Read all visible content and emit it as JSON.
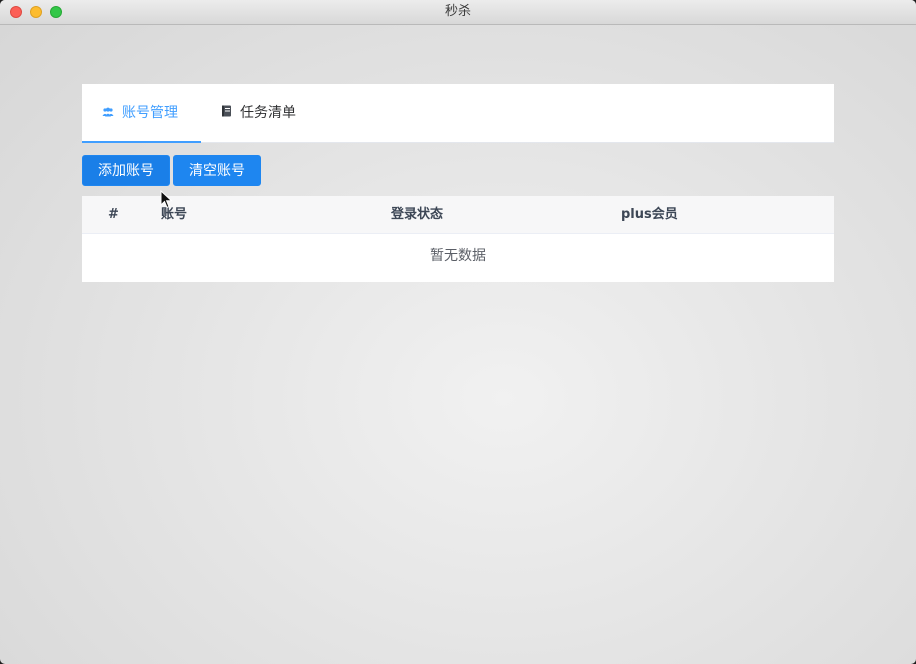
{
  "window": {
    "title": "秒杀"
  },
  "tabs": [
    {
      "label": "账号管理",
      "icon": "users-icon",
      "active": true
    },
    {
      "label": "任务清单",
      "icon": "book-icon",
      "active": false
    }
  ],
  "toolbar": {
    "add_label": "添加账号",
    "clear_label": "清空账号"
  },
  "table": {
    "columns": [
      "#",
      "账号",
      "登录状态",
      "plus会员"
    ],
    "rows": [],
    "empty_text": "暂无数据"
  },
  "colors": {
    "accent": "#409eff",
    "button": "#1e86f0"
  }
}
